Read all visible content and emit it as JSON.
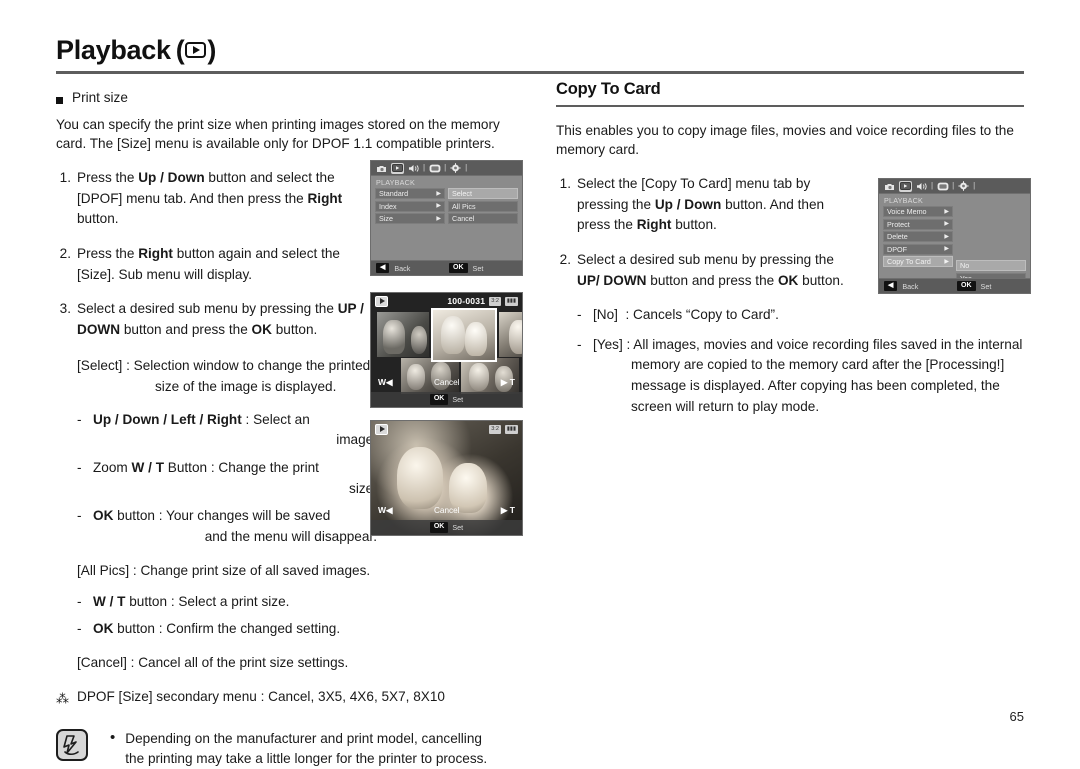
{
  "header": {
    "title": "Playback",
    "icon": "play-icon",
    "open_paren": "(",
    "close_paren": ")"
  },
  "left_column": {
    "section_label": "Print size",
    "intro": "You can specify the print size when printing images stored on the memory card. The [Size] menu is available only for DPOF 1.1 compatible printers.",
    "steps": [
      {
        "num": "1.",
        "html": "Press the <b>Up / Down</b> button and select the [DPOF] menu tab. And then press the <b>Right</b> button."
      },
      {
        "num": "2.",
        "html": "Press the <b>Right</b> button again and select the [Size]. Sub menu will display."
      },
      {
        "num": "3.",
        "html": "Select a desired sub menu by pressing the <b>UP / DOWN</b> button and press the <b>OK</b> button."
      }
    ],
    "select_block": "[Select] : Selection window to change the printed size of the image is displayed.",
    "select_dashes": [
      {
        "html": "<b>Up / Down / Left / Right</b> : Select an <span class=\"rt\">image.</span>"
      },
      {
        "html": "Zoom <b>W / T</b> Button : Change the print <span class=\"rt\">size.</span>"
      },
      {
        "html": "<b>OK</b> button : Your changes will be saved <span class=\"rt\">and the menu will disappear.</span>"
      }
    ],
    "allpics_block": "[All Pics] : Change print size of all saved images.",
    "allpics_dashes": [
      {
        "html": "<b>W / T</b> button : Select a print size."
      },
      {
        "html": "<b>OK</b> button : Confirm the changed setting."
      }
    ],
    "cancel_block": "[Cancel] : Cancel all of the print size settings.",
    "star_symbol": "⁂",
    "star_note": "DPOF [Size] secondary menu : Cancel, 3X5, 4X6, 5X7, 8X10",
    "note": {
      "icon": "note-pen-icon",
      "bullet": "•",
      "text": "Depending on the manufacturer and print model, cancelling the printing may take a little longer for the printer to process."
    }
  },
  "right_column": {
    "section_title": "Copy To Card",
    "intro": "This enables you to copy image files, movies and voice recording files to the memory card.",
    "steps": [
      {
        "num": "1.",
        "html": "Select the [Copy To Card] menu tab by pressing the <b>Up / Down</b> button. And then press the <b>Right</b> button."
      },
      {
        "num": "2.",
        "html": "Select a desired sub menu by pressing the <b>UP/ DOWN</b> button and press the <b>OK</b> button."
      }
    ],
    "dashes": [
      {
        "html": "[No]&nbsp; : Cancels “Copy to Card”."
      },
      {
        "html": "[Yes] : All images, movies and voice recording files saved in the internal memory are copied to the memory card after the [Processing!] message is displayed. After copying has been completed, the screen will return to play mode."
      }
    ]
  },
  "lcd_dpof": {
    "mode_label": "PLAYBACK",
    "icons": [
      "camera-icon",
      "play-icon",
      "sound-icon",
      "display-icon",
      "setup-icon"
    ],
    "selected_icon_index": 1,
    "menu_items": [
      {
        "label": "Standard",
        "arrow": "▶",
        "selected": false
      },
      {
        "label": "Index",
        "arrow": "▶",
        "selected": false
      },
      {
        "label": "Size",
        "arrow": "▶",
        "selected": false
      }
    ],
    "submenu_items": [
      {
        "label": "Select",
        "selected": true
      },
      {
        "label": "All Pics",
        "selected": false
      },
      {
        "label": "Cancel",
        "selected": false
      }
    ],
    "back_key": "◀",
    "back_label": "Back",
    "ok_key": "OK",
    "set_label": "Set"
  },
  "lcd_copy": {
    "mode_label": "PLAYBACK",
    "icons": [
      "camera-icon",
      "play-icon",
      "sound-icon",
      "display-icon",
      "setup-icon"
    ],
    "selected_icon_index": 1,
    "menu_items": [
      {
        "label": "Voice Memo",
        "arrow": "▶",
        "selected": false
      },
      {
        "label": "Protect",
        "arrow": "▶",
        "selected": false
      },
      {
        "label": "Delete",
        "arrow": "▶",
        "selected": false
      },
      {
        "label": "DPOF",
        "arrow": "▶",
        "selected": false
      },
      {
        "label": "Copy To Card",
        "arrow": "▶",
        "selected": true
      }
    ],
    "submenu_items": [
      {
        "label": "No",
        "selected": true
      },
      {
        "label": "Yes",
        "selected": false
      }
    ],
    "back_key": "◀",
    "back_label": "Back",
    "ok_key": "OK",
    "set_label": "Set"
  },
  "thumb_screen": {
    "file_number": "100-0031",
    "badge_left": "3:2",
    "badge_right": "▮▮▮",
    "zoom_wide": "W◀",
    "center_label": "Cancel",
    "zoom_tele": "▶ T",
    "ok_key": "OK",
    "set_label": "Set"
  },
  "photo_screen": {
    "badge_left": "3:2",
    "badge_right": "▮▮▮",
    "zoom_wide": "W◀",
    "center_label": "Cancel",
    "zoom_tele": "▶ T",
    "ok_key": "OK",
    "set_label": "Set"
  },
  "page_number": "65"
}
